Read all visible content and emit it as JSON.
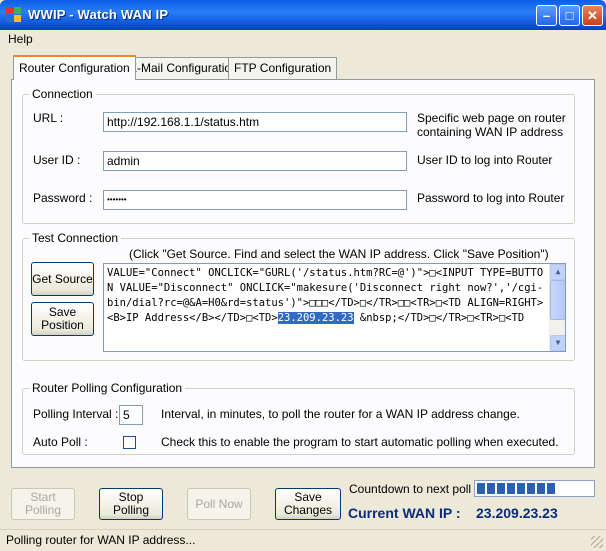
{
  "window": {
    "title": "WWIP - Watch WAN IP"
  },
  "menu": {
    "help": "Help"
  },
  "tabs": [
    "Router Configuration",
    "E-Mail Configuration",
    "FTP Configuration"
  ],
  "connection": {
    "legend": "Connection",
    "url_label": "URL :",
    "url_value": "http://192.168.1.1/status.htm",
    "url_desc_1": "Specific web page on router",
    "url_desc_2": "containing WAN IP address",
    "userid_label": "User ID :",
    "userid_value": "admin",
    "userid_desc": "User ID to log into Router",
    "password_label": "Password :",
    "password_value": "•••••••",
    "password_desc": "Password to log into Router"
  },
  "test_connection": {
    "legend": "Test Connection",
    "hint": "(Click \"Get Source. Find and select the WAN IP address. Click \"Save Position\")",
    "get_source_label": "Get Source",
    "save_position_label": "Save Position",
    "source_before": "VALUE=\"Connect\" ONCLICK=\"GURL('/status.htm?RC=@')\">□<INPUT TYPE=BUTTON VALUE=\"Disconnect\" ONCLICK=\"makesure('Disconnect right now?','/cgi-bin/dial?rc=@&A=H0&rd=status')\">□□□</TD>□</TR>□□<TR>□<TD ALIGN=RIGHT><B>IP Address</B></TD>□<TD>",
    "source_selected": "23.209.23.23",
    "source_after": " &nbsp;</TD>□</TR>□<TR>□<TD"
  },
  "polling": {
    "legend": "Router Polling Configuration",
    "interval_label": "Polling Interval :",
    "interval_value": "5",
    "interval_desc": "Interval, in minutes, to poll the router for a WAN IP address change.",
    "autopoll_label": "Auto  Poll :",
    "autopoll_checked": false,
    "autopoll_desc": "Check this to enable the program to start automatic polling when executed."
  },
  "buttons": {
    "start_polling": "Start Polling",
    "stop_polling": "Stop Polling",
    "poll_now": "Poll Now",
    "save_changes": "Save Changes"
  },
  "countdown": {
    "label": "Countdown to next poll :",
    "progress": 0.75
  },
  "wan": {
    "label": "Current WAN IP :",
    "value": "23.209.23.23"
  },
  "status": {
    "text": "Polling router for WAN IP address..."
  }
}
